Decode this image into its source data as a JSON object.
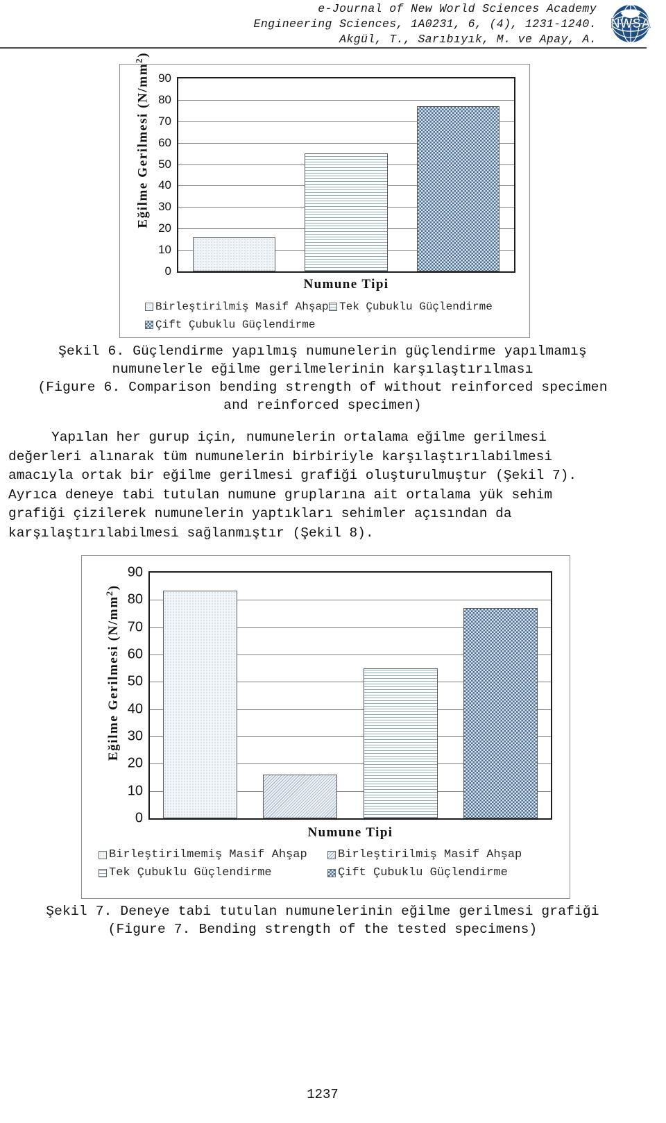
{
  "header": {
    "line1": "e-Journal of New World Sciences Academy",
    "line2": "Engineering Sciences, 1A0231, 6, (4), 1231-1240.",
    "line3": "Akgül, T., Sarıbıyık, M. ve Apay, A.",
    "logo_text": "NWSA",
    "logo_name": "nwsa-globe-logo"
  },
  "figure6": {
    "caption_tr_line1": "Şekil 6. Güçlendirme yapılmış numunelerin güçlendirme yapılmamış",
    "caption_tr_line2": "numunelerle eğilme gerilmelerinin karşılaştırılması",
    "caption_en_line1": "(Figure 6. Comparison bending strength of without reinforced specimen",
    "caption_en_line2": "and reinforced specimen)"
  },
  "figure7": {
    "caption_tr": "Şekil 7. Deneye tabi tutulan numunelerinin eğilme gerilmesi grafiği",
    "caption_en": "(Figure 7. Bending strength of the tested specimens)"
  },
  "body": {
    "para1_l1": "Yapılan her gurup için, numunelerin ortalama eğilme gerilmesi",
    "para1_l2": "değerleri alınarak tüm numunelerin birbiriyle karşılaştırılabilmesi",
    "para1_l3": "amacıyla ortak bir eğilme gerilmesi grafiği oluşturulmuştur (Şekil 7).",
    "para1_l4": "Ayrıca deneye tabi tutulan numune gruplarına ait ortalama yük sehim",
    "para1_l5": "grafiği çizilerek numunelerin yaptıkları sehimler açısından da",
    "para1_l6": "karşılaştırılabilmesi sağlanmıştır (Şekil 8)."
  },
  "footer": {
    "page_number": "1237"
  },
  "chart_data": [
    {
      "id": "figure-6-chart",
      "type": "bar",
      "title": "",
      "xlabel": "Numune Tipi",
      "ylabel": "Eğilme Gerilmesi  (N/mm²)",
      "ylabel_main": "Eğilme Gerilmesi  (N/mm",
      "ylabel_sup": "2",
      "ylabel_tail": ")",
      "ylim": [
        0,
        90
      ],
      "yticks": [
        0,
        10,
        20,
        30,
        40,
        50,
        60,
        70,
        80,
        90
      ],
      "grid": true,
      "legend_position": "bottom",
      "categories": [
        "Birleştirilmiş Masif Ahşap",
        "Tek Çubuklu Güçlendirme",
        "Çift Çubuklu Güçlendirme"
      ],
      "values": [
        16,
        55,
        77
      ],
      "patterns": [
        "dots-light",
        "h-lines",
        "checker"
      ],
      "legend": [
        {
          "label": "Birleştirilmiş Masif Ahşap",
          "pattern": "dots-light"
        },
        {
          "label": "Tek Çubuklu Güçlendirme",
          "pattern": "h-lines"
        },
        {
          "label": "Çift Çubuklu Güçlendirme",
          "pattern": "checker"
        }
      ]
    },
    {
      "id": "figure-7-chart",
      "type": "bar",
      "title": "",
      "xlabel": "Numune Tipi",
      "ylabel": "Eğilme Gerilmesi  (N/mm²)",
      "ylabel_main": "Eğilme Gerilmesi  (N/mm",
      "ylabel_sup": "2",
      "ylabel_tail": ")",
      "ylim": [
        0,
        90
      ],
      "yticks": [
        0,
        10,
        20,
        30,
        40,
        50,
        60,
        70,
        80,
        90
      ],
      "grid": true,
      "legend_position": "bottom",
      "categories": [
        "Birleştirilmemiş Masif Ahşap",
        "Birleştirilmiş Masif Ahşap",
        "Tek Çubuklu Güçlendirme",
        "Çift Çubuklu Güçlendirme"
      ],
      "values": [
        83.5,
        16,
        55,
        77
      ],
      "patterns": [
        "plain-dots",
        "diag-dense",
        "h-lines",
        "checker"
      ],
      "legend": [
        {
          "label": "Birleştirilmemiş Masif Ahşap",
          "pattern": "plain-dots"
        },
        {
          "label": "Birleştirilmiş Masif Ahşap",
          "pattern": "diag-dense"
        },
        {
          "label": "Tek Çubuklu Güçlendirme",
          "pattern": "h-lines"
        },
        {
          "label": "Çift Çubuklu Güçlendirme",
          "pattern": "checker"
        }
      ]
    }
  ]
}
